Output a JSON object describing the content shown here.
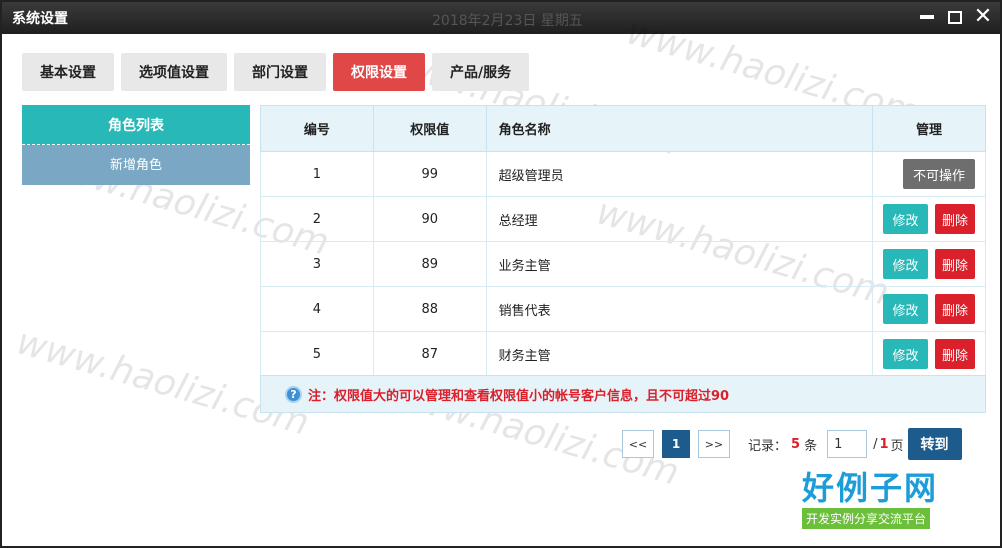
{
  "window": {
    "title": "系统设置",
    "ghost_text": "2018年2月23日 星期五",
    "minimize_label": "",
    "close_label": "✕"
  },
  "tabs": [
    {
      "label": "基本设置"
    },
    {
      "label": "选项值设置"
    },
    {
      "label": "部门设置"
    },
    {
      "label": "权限设置",
      "active": true
    },
    {
      "label": "产品/服务"
    }
  ],
  "sidebar": {
    "header": "角色列表",
    "items": [
      {
        "label": "新增角色"
      }
    ]
  },
  "table": {
    "headers": [
      "编号",
      "权限值",
      "角色名称",
      "管理"
    ],
    "rows": [
      {
        "id": "1",
        "value": "99",
        "name": "超级管理员",
        "action_na": "不可操作"
      },
      {
        "id": "2",
        "value": "90",
        "name": "总经理",
        "edit": "修改",
        "delete": "删除"
      },
      {
        "id": "3",
        "value": "89",
        "name": "业务主管",
        "edit": "修改",
        "delete": "删除"
      },
      {
        "id": "4",
        "value": "88",
        "name": "销售代表",
        "edit": "修改",
        "delete": "删除"
      },
      {
        "id": "5",
        "value": "87",
        "name": "财务主管",
        "edit": "修改",
        "delete": "删除"
      }
    ]
  },
  "note": {
    "icon": "?",
    "text": "注：权限值大的可以管理和查看权限值小的帐号客户信息，且不可超过90"
  },
  "pager": {
    "first": "<<",
    "current": "1",
    "next": ">>",
    "records_label": "记录：",
    "records_count": "5",
    "records_unit": "条",
    "page_input": "1",
    "total_prefix": "/",
    "total_pages": "1",
    "total_suffix": "页",
    "go": "转到"
  },
  "watermark": "www.haolizi.com",
  "logo": {
    "main": "好例子网",
    "sub": "开发实例分享交流平台"
  },
  "colors": {
    "accent_teal": "#28b8b8",
    "active_tab": "#e04848",
    "danger": "#d9202b",
    "pager_blue": "#1d5b8c"
  }
}
